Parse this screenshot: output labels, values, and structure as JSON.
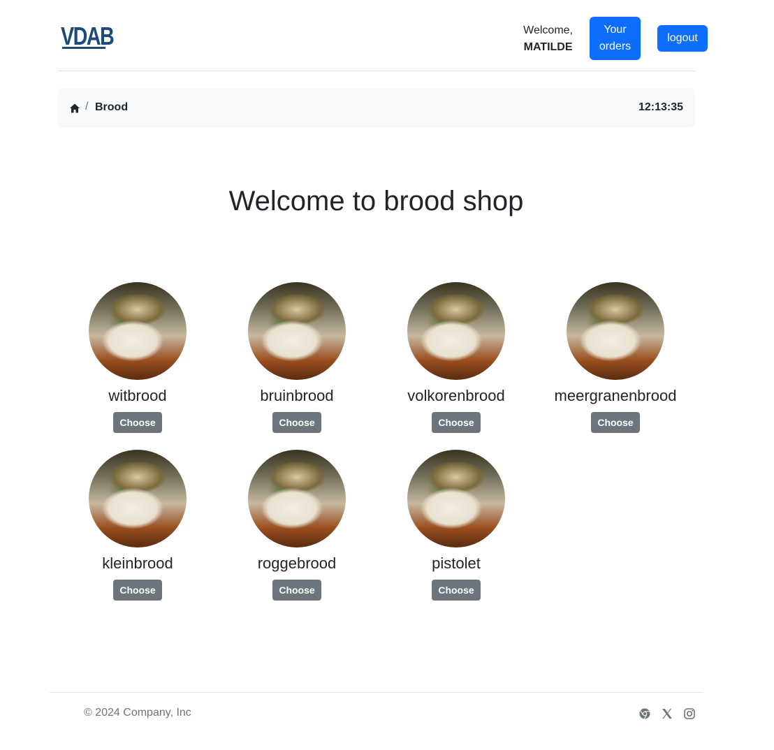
{
  "header": {
    "logo": "VDAB",
    "welcome_text": "Welcome,",
    "user_name": "MATILDE",
    "orders_line1": "Your",
    "orders_line2": "orders",
    "logout_label": "logout"
  },
  "breadcrumb": {
    "separator": "/",
    "current": "Brood",
    "clock": "12:13:35"
  },
  "main": {
    "title": "Welcome to brood shop",
    "products": [
      {
        "name": "witbrood",
        "button": "Choose"
      },
      {
        "name": "bruinbrood",
        "button": "Choose"
      },
      {
        "name": "volkorenbrood",
        "button": "Choose"
      },
      {
        "name": "meergranenbrood",
        "button": "Choose"
      },
      {
        "name": "kleinbrood",
        "button": "Choose"
      },
      {
        "name": "roggebrood",
        "button": "Choose"
      },
      {
        "name": "pistolet",
        "button": "Choose"
      }
    ]
  },
  "footer": {
    "copyright": "© 2024 Company, Inc",
    "social_icons": [
      "chrome-icon",
      "x-twitter-icon",
      "instagram-icon"
    ]
  },
  "colors": {
    "primary": "#0d6efd",
    "secondary": "#6c757d",
    "logo": "#1c4a7a",
    "breadcrumb_bg": "#f8f9fa"
  }
}
